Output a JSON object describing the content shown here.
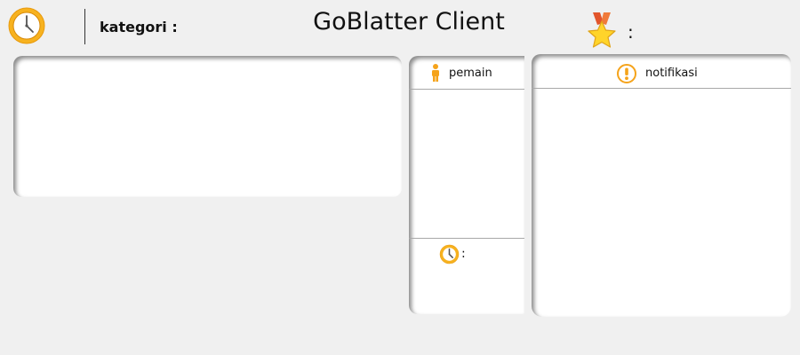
{
  "header": {
    "category_label": "kategori :",
    "title": "GoBlatter Client",
    "medal_colon": ":"
  },
  "players_panel": {
    "header_label": "pemain",
    "timer_colon": ":"
  },
  "notifications_panel": {
    "header_label": "notifikasi"
  },
  "icons": {
    "main_clock": "clock-icon",
    "medal": "medal-star-icon",
    "player": "person-icon",
    "timer": "clock-icon",
    "alert": "exclamation-icon"
  },
  "colors": {
    "background": "#f0f0f0",
    "panel": "#ffffff",
    "accent_orange": "#f5a31a",
    "medal_red": "#e2552b",
    "star_yellow": "#ffd42a"
  }
}
